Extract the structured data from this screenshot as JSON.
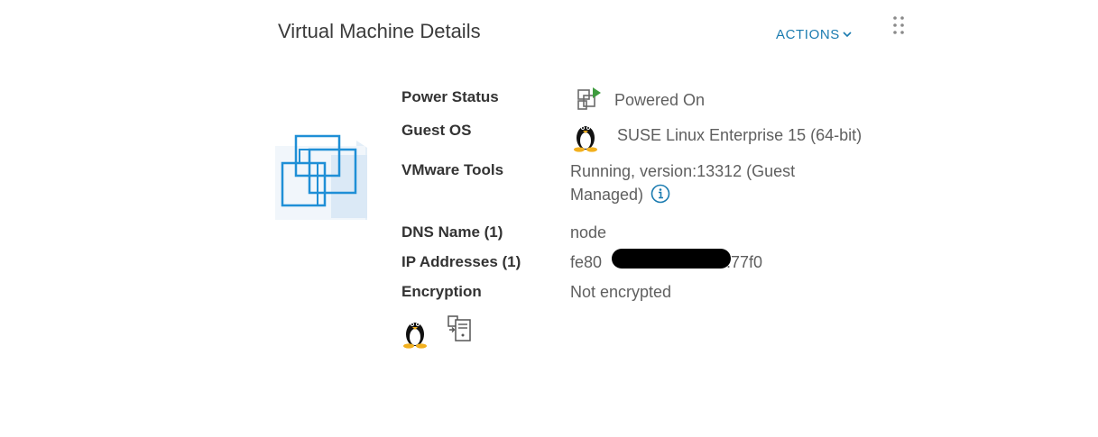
{
  "panel": {
    "title": "Virtual Machine Details",
    "actions_label": "ACTIONS",
    "accent_color": "#1a7bb0"
  },
  "details": {
    "power_status": {
      "label": "Power Status",
      "value": "Powered On",
      "icon": "vm-powered-on-icon"
    },
    "guest_os": {
      "label": "Guest OS",
      "value": "SUSE Linux Enterprise 15 (64-bit)",
      "icon": "linux-penguin-icon"
    },
    "vmware_tools": {
      "label": "VMware Tools",
      "value_line1": "Running, version:13312 (Guest",
      "value_line2": "Managed)",
      "icon": "info-icon"
    },
    "dns_name": {
      "label": "DNS Name (1)",
      "value": "node"
    },
    "ip_addresses": {
      "label": "IP Addresses (1)",
      "value_prefix": "fe80",
      "value_suffix": ":77f0"
    },
    "encryption": {
      "label": "Encryption",
      "value": "Not encrypted"
    }
  },
  "bottom_icons": [
    "linux-penguin-icon",
    "vm-server-icon"
  ]
}
